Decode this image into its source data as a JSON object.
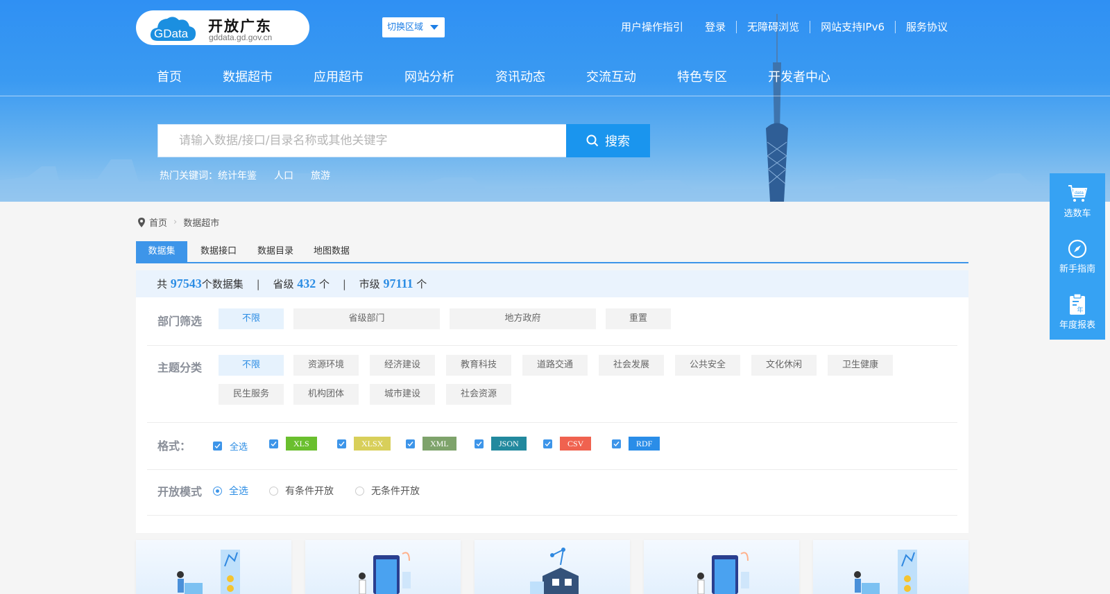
{
  "header": {
    "logo_badge": "GData",
    "logo_title": "开放广东",
    "logo_domain": "gddata.gd.gov.cn",
    "region_button": "切换区域",
    "top_links": [
      "用户操作指引",
      "登录",
      "无障碍浏览",
      "网站支持IPv6",
      "服务协议"
    ],
    "nav": [
      "首页",
      "数据超市",
      "应用超市",
      "网站分析",
      "资讯动态",
      "交流互动",
      "特色专区",
      "开发者中心"
    ]
  },
  "search": {
    "placeholder": "请输入数据/接口/目录名称或其他关键字",
    "button_label": "搜索",
    "hot_label": "热门关键词：",
    "hot_keywords": [
      "统计年鉴",
      "人口",
      "旅游"
    ]
  },
  "side_bar": [
    {
      "label": "选数车",
      "icon": "cart-icon",
      "icon_text": "data"
    },
    {
      "label": "新手指南",
      "icon": "compass-icon"
    },
    {
      "label": "年度报表",
      "icon": "report-icon",
      "icon_text": "年"
    }
  ],
  "breadcrumb": [
    "首页",
    "数据超市"
  ],
  "tabs": [
    "数据集",
    "数据接口",
    "数据目录",
    "地图数据"
  ],
  "stats": {
    "prefix": "共",
    "total": "97543",
    "total_suffix": "个数据集",
    "provincial_label": "省级",
    "provincial": "432",
    "unit": "个",
    "city_label": "市级",
    "city": "97111"
  },
  "filters": {
    "dept_label": "部门筛选",
    "dept_options": [
      "不限",
      "省级部门",
      "地方政府",
      "重置"
    ],
    "topic_label": "主题分类",
    "topic_options": [
      "不限",
      "资源环境",
      "经济建设",
      "教育科技",
      "道路交通",
      "社会发展",
      "公共安全",
      "文化休闲",
      "卫生健康",
      "民生服务",
      "机构团体",
      "城市建设",
      "社会资源"
    ],
    "format_label": "格式：",
    "format_all": "全选",
    "formats": [
      {
        "name": "XLS",
        "color": "#6abf2e"
      },
      {
        "name": "XLSX",
        "color": "#d8cf5a"
      },
      {
        "name": "XML",
        "color": "#7ea36b"
      },
      {
        "name": "JSON",
        "color": "#22899e"
      },
      {
        "name": "CSV",
        "color": "#f0624f"
      },
      {
        "name": "RDF",
        "color": "#2a8de8"
      }
    ],
    "mode_label": "开放模式",
    "mode_options": [
      "全选",
      "有条件开放",
      "无条件开放"
    ],
    "mode_selected": "全选"
  },
  "colors": {
    "primary": "#3d95e9",
    "search_button": "#1a95ee",
    "side_bar": "#36a2f3"
  }
}
